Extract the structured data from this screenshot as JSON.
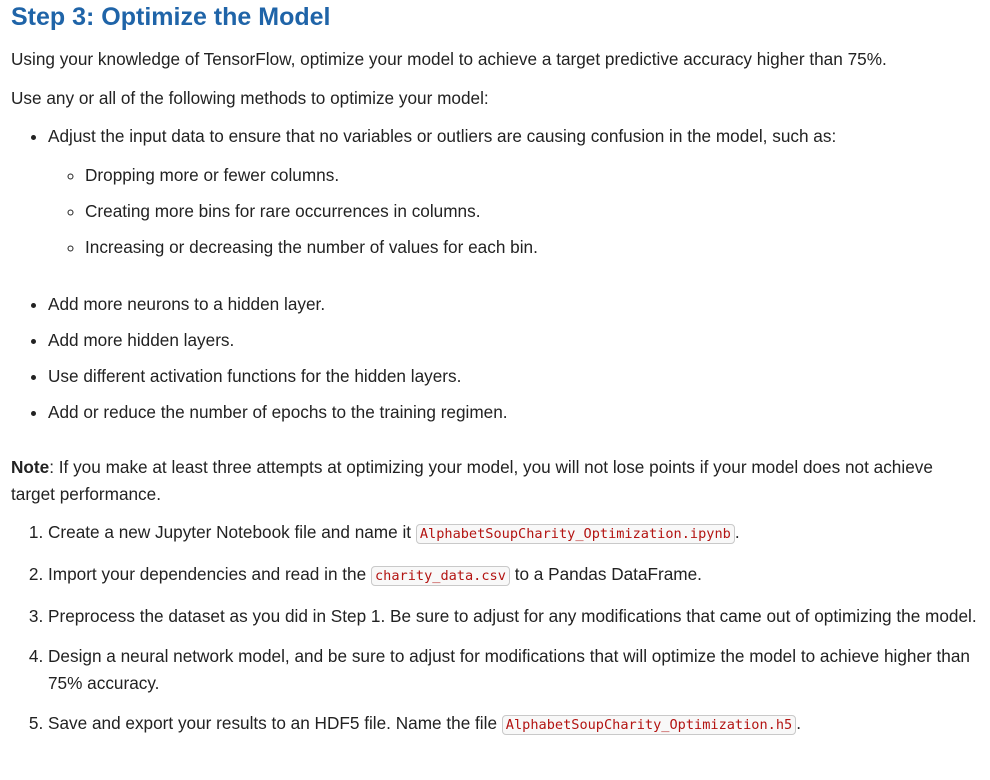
{
  "heading": "Step 3: Optimize the Model",
  "intro": "Using your knowledge of TensorFlow, optimize your model to achieve a target predictive accuracy higher than 75%.",
  "methods_intro": "Use any or all of the following methods to optimize your model:",
  "methods": [
    {
      "text": "Adjust the input data to ensure that no variables or outliers are causing confusion in the model, such as:"
    },
    {
      "text": "Add more neurons to a hidden layer."
    },
    {
      "text": "Add more hidden layers."
    },
    {
      "text": "Use different activation functions for the hidden layers."
    },
    {
      "text": "Add or reduce the number of epochs to the training regimen."
    }
  ],
  "sub_methods": [
    "Dropping more or fewer columns.",
    "Creating more bins for rare occurrences in columns.",
    "Increasing or decreasing the number of values for each bin."
  ],
  "note": {
    "label": "Note",
    "text": ": If you make at least three attempts at optimizing your model, you will not lose points if your model does not achieve target performance."
  },
  "steps": [
    {
      "before": "Create a new Jupyter Notebook file and name it ",
      "code": "AlphabetSoupCharity_Optimization.ipynb",
      "after": "."
    },
    {
      "before": "Import your dependencies and read in the ",
      "code": "charity_data.csv",
      "after": " to a Pandas DataFrame."
    },
    {
      "before": "Preprocess the dataset as you did in Step 1. Be sure to adjust for any modifications that came out of optimizing the model."
    },
    {
      "before": "Design a neural network model, and be sure to adjust for modifications that will optimize the model to achieve higher than 75% accuracy."
    },
    {
      "before": "Save and export your results to an HDF5 file. Name the file ",
      "code": "AlphabetSoupCharity_Optimization.h5",
      "after": "."
    }
  ]
}
